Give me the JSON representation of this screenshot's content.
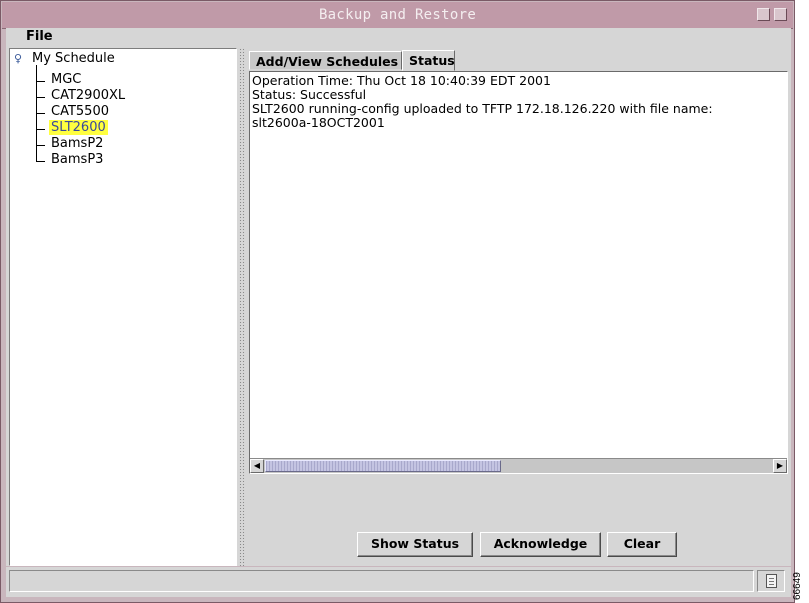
{
  "window": {
    "title": "Backup and Restore"
  },
  "menubar": {
    "file_label": "File"
  },
  "tree": {
    "root_label": "My Schedule",
    "items": [
      {
        "label": "MGC",
        "selected": false
      },
      {
        "label": "CAT2900XL",
        "selected": false
      },
      {
        "label": "CAT5500",
        "selected": false
      },
      {
        "label": "SLT2600",
        "selected": true
      },
      {
        "label": "BamsP2",
        "selected": false
      },
      {
        "label": "BamsP3",
        "selected": false
      }
    ]
  },
  "tabs": {
    "add_view_label": "Add/View Schedules",
    "status_label": "Status",
    "active": "Status"
  },
  "status": {
    "lines": [
      "Operation Time: Thu Oct 18 10:40:39 EDT 2001",
      "Status: Successful",
      "SLT2600 running-config uploaded to TFTP 172.18.126.220 with file name:",
      "slt2600a-18OCT2001"
    ]
  },
  "buttons": {
    "show_status": "Show Status",
    "acknowledge": "Acknowledge",
    "clear": "Clear"
  },
  "figure_id": "66649",
  "colors": {
    "titlebar": "#c09aa8",
    "selection_highlight": "#ffff40",
    "panel": "#d6d6d6"
  }
}
